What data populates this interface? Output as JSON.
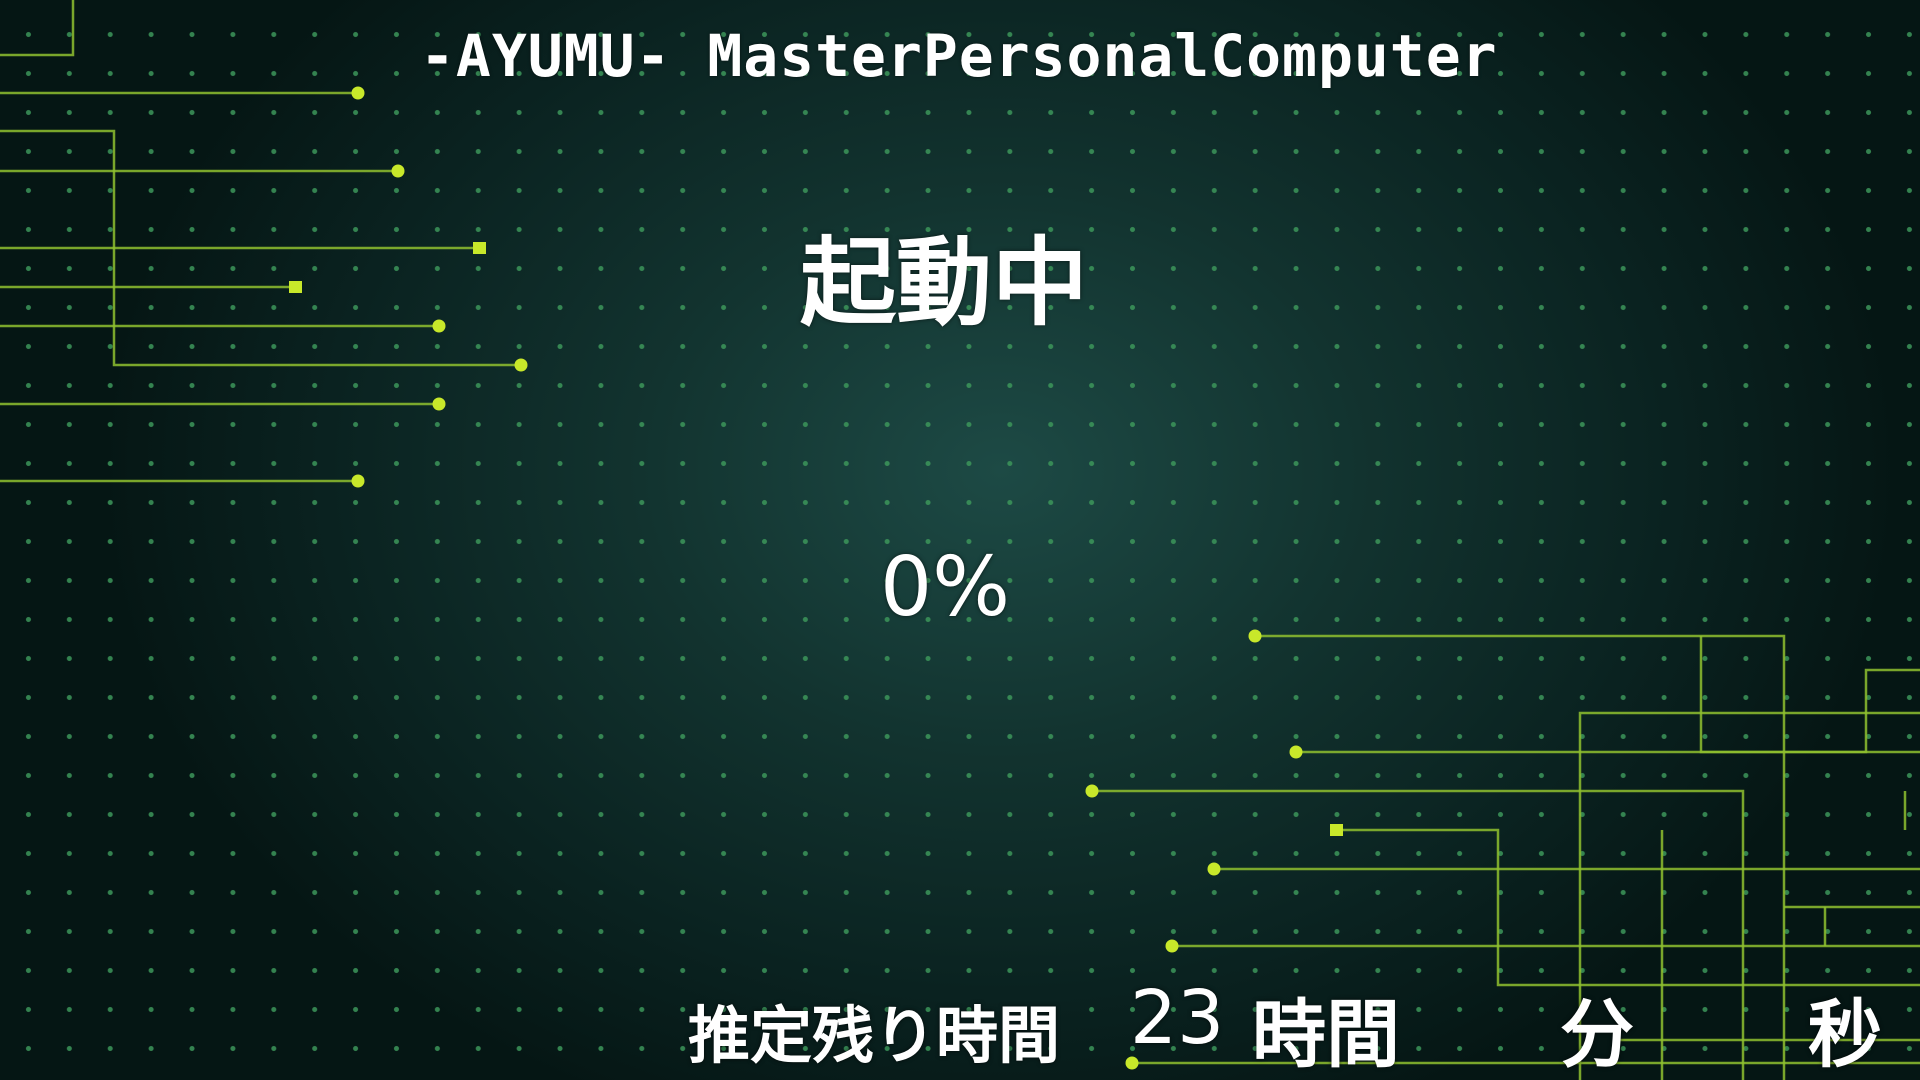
{
  "header": {
    "title": "-AYUMU- MasterPersonalComputer"
  },
  "boot": {
    "status": "起動中",
    "progress_text": "0%",
    "progress_fraction": 0.0
  },
  "remaining": {
    "label": "推定残り時間",
    "hours_value": "23",
    "hours_unit": "時間",
    "minutes_unit": "分",
    "seconds_unit": "秒"
  },
  "colors": {
    "background": "#12332f",
    "circuit_line": "#8fbf2f",
    "circuit_node": "#c8e82a",
    "grid_dot": "#3c965a",
    "text": "#ffffff"
  }
}
